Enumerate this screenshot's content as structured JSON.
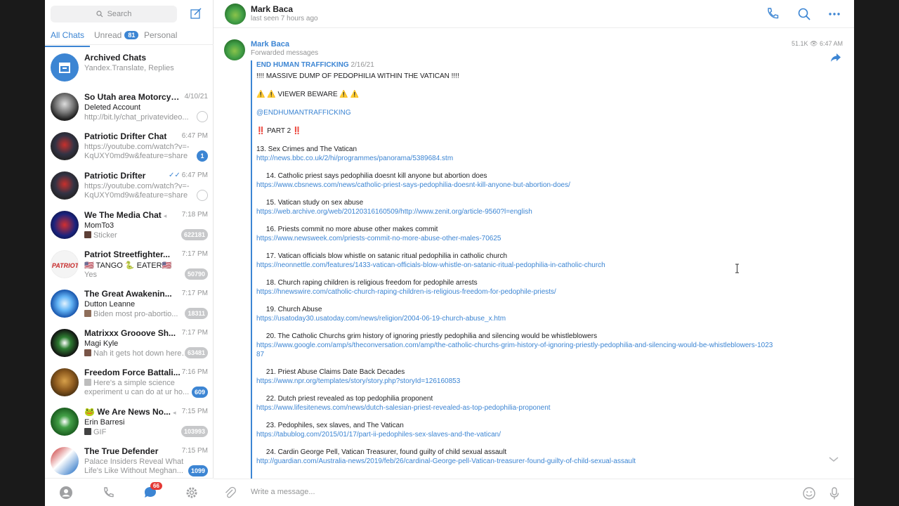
{
  "sidebar": {
    "search_placeholder": "Search",
    "tabs": [
      {
        "label": "All Chats",
        "count": ""
      },
      {
        "label": "Unread",
        "count": "81"
      },
      {
        "label": "Personal",
        "count": ""
      }
    ],
    "chats": [
      {
        "title": "Archived Chats",
        "time": "",
        "line1": "Yandex.Translate, Replies",
        "line2": "",
        "badge": "",
        "badge_style": "none"
      },
      {
        "title": "So Utah area Motorcycle Ri...",
        "time": "4/10/21",
        "sender": "Deleted Account",
        "line2": "http://bit.ly/chat_privatevideo...",
        "badge": "",
        "badge_style": "pin"
      },
      {
        "title": "Patriotic Drifter Chat",
        "time": "6:47 PM",
        "line1": "https://youtube.com/watch?v=-KqUXY0md9w&feature=share",
        "badge": "1",
        "badge_style": "blue"
      },
      {
        "title": "Patriotic Drifter",
        "time": "6:47 PM",
        "ticks": "✓✓",
        "line1": "https://youtube.com/watch?v=-KqUXY0md9w&feature=share",
        "badge": "",
        "badge_style": "pin"
      },
      {
        "title": "We The Media Chat",
        "time": "7:18 PM",
        "sender": "MomTo3",
        "line2": "Sticker",
        "badge": "622181",
        "badge_style": "muted"
      },
      {
        "title": "Patriot Streetfighter...",
        "time": "7:17 PM",
        "sender": "🇺🇸 TANGO 🐍 EATER🇺🇸",
        "line2": "Yes",
        "badge": "50790",
        "badge_style": "muted"
      },
      {
        "title": "The Great Awakenin...",
        "time": "7:17 PM",
        "sender": "Dutton Leanne",
        "line2": "Biden most pro-abortio...",
        "badge": "18311",
        "badge_style": "muted"
      },
      {
        "title": "Matrixxx Grooove Sh...",
        "time": "7:17 PM",
        "sender": "Magi Kyle",
        "line2": "Nah it gets hot down here i...",
        "badge": "63481",
        "badge_style": "muted"
      },
      {
        "title": "Freedom Force Battali...",
        "time": "7:16 PM",
        "line1": "Here's a simple science experiment u can do at ur ho...",
        "badge": "609",
        "badge_style": "blue"
      },
      {
        "title": "🐸 We Are News No...",
        "time": "7:15 PM",
        "sender": "Erin Barresi",
        "line2": "GIF",
        "badge": "103993",
        "badge_style": "muted"
      },
      {
        "title": "The True Defender",
        "time": "7:15 PM",
        "line1": "Palace Insiders Reveal What Life's Like Without Meghan...",
        "badge": "1099",
        "badge_style": "blue"
      }
    ],
    "bottom_badge": "66"
  },
  "chat": {
    "name": "Mark Baca",
    "status": "last seen 7 hours ago",
    "message": {
      "author": "Mark Baca",
      "forwarded_label": "Forwarded messages",
      "views": "51.1K",
      "time": "6:47 AM",
      "origin": "END HUMAN TRAFFICKING",
      "origin_date": "2/16/21",
      "headline": "!!!! MASSIVE DUMP OF PEDOPHILIA WITHIN THE VATICAN !!!!",
      "warning": "⚠️ ⚠️  VIEWER BEWARE  ⚠️ ⚠️",
      "handle": "@ENDHUMANTRAFFICKING",
      "part": "‼️ PART 2 ‼️",
      "items": [
        {
          "title": "13. Sex Crimes and The Vatican",
          "url": "http://news.bbc.co.uk/2/hi/programmes/panorama/5389684.stm"
        },
        {
          "title": "     14. Catholic priest says pedophilia doesnt kill anyone but abortion does",
          "url": "https://www.cbsnews.com/news/catholic-priest-says-pedophilia-doesnt-kill-anyone-but-abortion-does/"
        },
        {
          "title": "     15. Vatican study on sex abuse",
          "url": "https://web.archive.org/web/20120316160509/http://www.zenit.org/article-9560?l=english"
        },
        {
          "title": "     16. Priests commit no more abuse other makes commit",
          "url": "https://www.newsweek.com/priests-commit-no-more-abuse-other-males-70625"
        },
        {
          "title": "     17. Vatican officials blow whistle on satanic ritual pedophilia in catholic church",
          "url": "https://neonnettle.com/features/1433-vatican-officials-blow-whistle-on-satanic-ritual-pedophilia-in-catholic-church"
        },
        {
          "title": "     18. Church raping children is religious freedom for pedophile arrests",
          "url": "https://hnewswire.com/catholic-church-raping-children-is-religious-freedom-for-pedophile-priests/"
        },
        {
          "title": "     19. Church Abuse",
          "url": "https://usatoday30.usatoday.com/news/religion/2004-06-19-church-abuse_x.htm"
        },
        {
          "title": "     20. The Catholic Churchs grim history of ignoring priestly pedophilia and silencing would be whistleblowers",
          "url": "https://www.google.com/amp/s/theconversation.com/amp/the-catholic-churchs-grim-history-of-ignoring-priestly-pedophilia-and-silencing-would-be-whistleblowers-102387"
        },
        {
          "title": "     21. Priest Abuse Claims Date Back Decades",
          "url": "https://www.npr.org/templates/story/story.php?storyId=126160853"
        },
        {
          "title": "     22. Dutch priest revealed as top pedophilia proponent",
          "url": "https://www.lifesitenews.com/news/dutch-salesian-priest-revealed-as-top-pedophilia-proponent"
        },
        {
          "title": "     23. Pedophiles, sex slaves, and The Vatican",
          "url": "https://tabublog.com/2015/01/17/part-ii-pedophiles-sex-slaves-and-the-vatican/"
        },
        {
          "title": "     24. Cardin George Pell, Vatican Treasurer, found guilty of child sexual assault",
          "url": "http://guardian.com/Australia-news/2019/feb/26/cardinal-George-pell-Vatican-treasurer-found-guilty-of-child-sexual-assault"
        }
      ]
    },
    "composer_placeholder": "Write a message..."
  },
  "colors": {
    "accent": "#3c85d3",
    "muted_badge": "#c7c8ca",
    "alert_badge": "#e53935"
  },
  "icons": [
    "search-icon",
    "compose-icon",
    "phone-icon",
    "more-icon",
    "share-icon",
    "attach-icon",
    "emoji-icon",
    "mic-icon",
    "contacts-icon",
    "calls-icon",
    "chats-icon",
    "settings-icon",
    "chevron-down-icon"
  ]
}
